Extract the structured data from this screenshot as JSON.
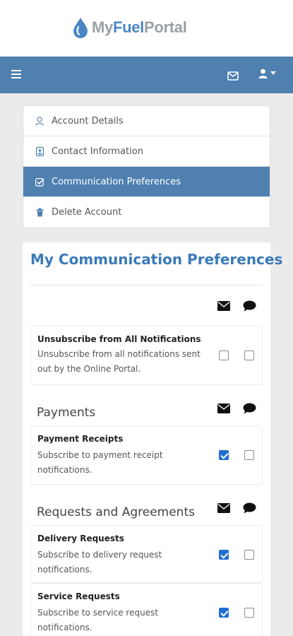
{
  "brand": {
    "name_part1": "My",
    "name_part2": "Fuel",
    "name_part3": "Portal",
    "accent_color": "#4f80b0",
    "logo_drop_color": "#4a86c5"
  },
  "navbar": {
    "menu_icon": "hamburger-icon",
    "mail_icon": "envelope-icon",
    "user_icon": "user-icon"
  },
  "menu": {
    "items": [
      {
        "label": "Account Details",
        "icon": "user-outline-icon",
        "active": false
      },
      {
        "label": "Contact Information",
        "icon": "contact-card-icon",
        "active": false
      },
      {
        "label": "Communication Preferences",
        "icon": "checkbox-check-icon",
        "active": true
      },
      {
        "label": "Delete Account",
        "icon": "trash-icon",
        "active": false
      }
    ]
  },
  "preferences": {
    "title": "My Communication Preferences",
    "column_icons": {
      "email": "envelope-icon",
      "sms": "chat-bubble-icon"
    },
    "general": {
      "name": "Unsubscribe from All Notifications",
      "description": "Unsubscribe from all notifications sent out by the Online Portal.",
      "email_checked": false,
      "sms_checked": false
    },
    "sections": [
      {
        "title": "Payments",
        "items": [
          {
            "name": "Payment Receipts",
            "description": "Subscribe to payment receipt notifications.",
            "email_checked": true,
            "sms_checked": false
          }
        ]
      },
      {
        "title": "Requests and Agreements",
        "items": [
          {
            "name": "Delivery Requests",
            "description": "Subscribe to delivery request notifications.",
            "email_checked": true,
            "sms_checked": false
          },
          {
            "name": "Service Requests",
            "description": "Subscribe to service request notifications.",
            "email_checked": true,
            "sms_checked": false
          }
        ]
      }
    ]
  }
}
